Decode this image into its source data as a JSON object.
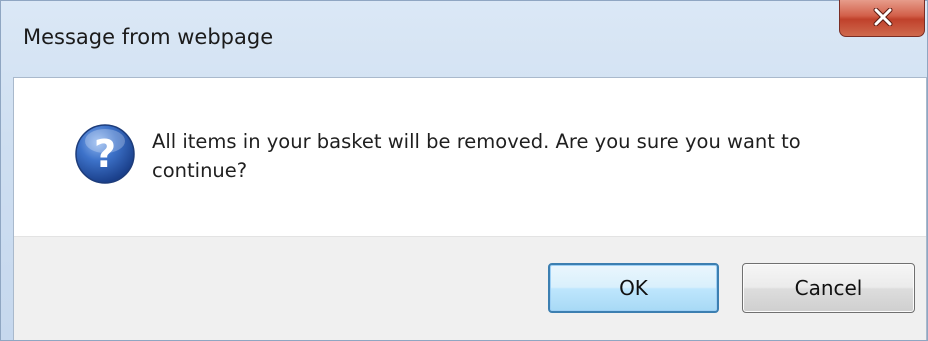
{
  "dialog": {
    "title": "Message from webpage",
    "close_icon": "close-x-icon",
    "message_icon": "question-icon",
    "message": "All items in your basket will be removed. Are you sure you want to continue?",
    "ok_label": "OK",
    "cancel_label": "Cancel"
  },
  "colors": {
    "titlebar": "#cfdff1",
    "close_button": "#c0412b",
    "icon_blue": "#2a5fb0",
    "ok_border": "#3c7fb1",
    "button_area": "#f0f0f0"
  }
}
